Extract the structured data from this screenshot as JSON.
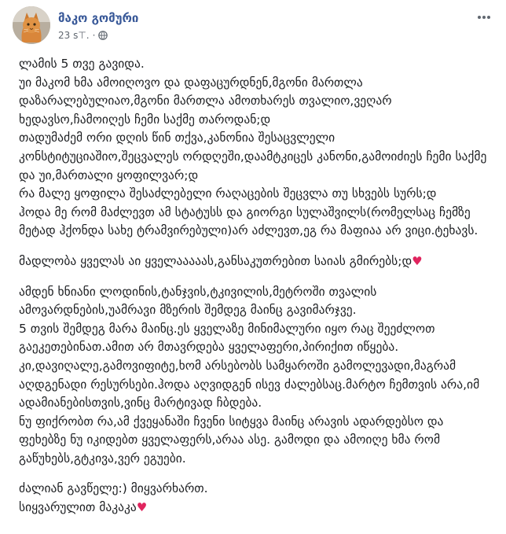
{
  "post": {
    "author": "მაკო გომური",
    "time": "23 ѕ⊤.",
    "separator": "·",
    "privacy_icon": "globe-icon",
    "more_icon": "ellipsis-icon",
    "paragraphs": [
      {
        "text": "ლამის 5 თვე გავიდა.\nუი მაკომ ხმა ამოიღოვო და დაფაცურდნენ,მგონი მართლა დაზარალებულიაო,მგონი მართლა ამოთხარეს თვალიო,ვეღარ ხედავსო,ჩამოიღეს ჩემი საქმე თაროდან;დ\nთადუმაძემ ორი დღის წინ თქვა,კანონია შესაცვლელი კონსტიტუციაშიო,შეცვალეს ორდღეში,დაამტკიცეს კანონი,გამოიძიეს ჩემი საქმე და უი,მართალი ყოფილვარ;დ\nრა მალე ყოფილა შესაძლებელი რაღაცების შეცვლა თუ სხვებს სურს;დ\nჰოდა მე რომ მაძლევთ ამ სტატუსს და გიორგი სულაშვილს(რომელსაც ჩემზე მეტად ჰქონდა სახე ტრამვირებული)არ აძლევთ,ეგ რა მაფიაა არ ვიცი.ტეხავს.",
        "heart": ""
      },
      {
        "text": "მადლობა ყველას აი ყველააააას,განსაკუთრებით საიას გმირებს;დ",
        "heart": "♥"
      },
      {
        "text": "ამდენ ხნიანი ლოდინის,ტანჯვის,ტკივილის,მეტროში თვალის ამოვარდნების,უამრავი მზერის შემდეგ მაინც გავიმარჯვე.\n5 თვის შემდეგ მარა მაინც.ეს ყველაზე მინიმალური იყო რაც შეეძლოთ გაეკეთებინათ.ამით არ მთავრდება ყველაფერი,პირიქით იწყება.\nკი,დავიღალე,გამოვიფიტე,ხომ არსებობს სამყაროში გამოლევადი,მაგრამ აღდგენადი რესურსები.ჰოდა აღვიდგენ ისევ ძალებსაც.მარტო ჩემთვის არა,იმ ადამიანებისთვის,ვინც მარტივად ჩბდება.\nნუ ფიქრობთ რა,ამ ქვეყანაში ჩვენი სიტყვა მაინც არავის ადარდებსო და ფეხებზე ნუ იკიდებთ ყველაფერს,არაა ასე. გამოდი და ამოიღე ხმა რომ გაწუხებს,გტკივა,ვერ ეგუები.",
        "heart": ""
      },
      {
        "text": "ძალიან გავწელე:) მიყვარხართ.\nსიყვარულით მაკაკა",
        "heart": "♥"
      }
    ]
  }
}
